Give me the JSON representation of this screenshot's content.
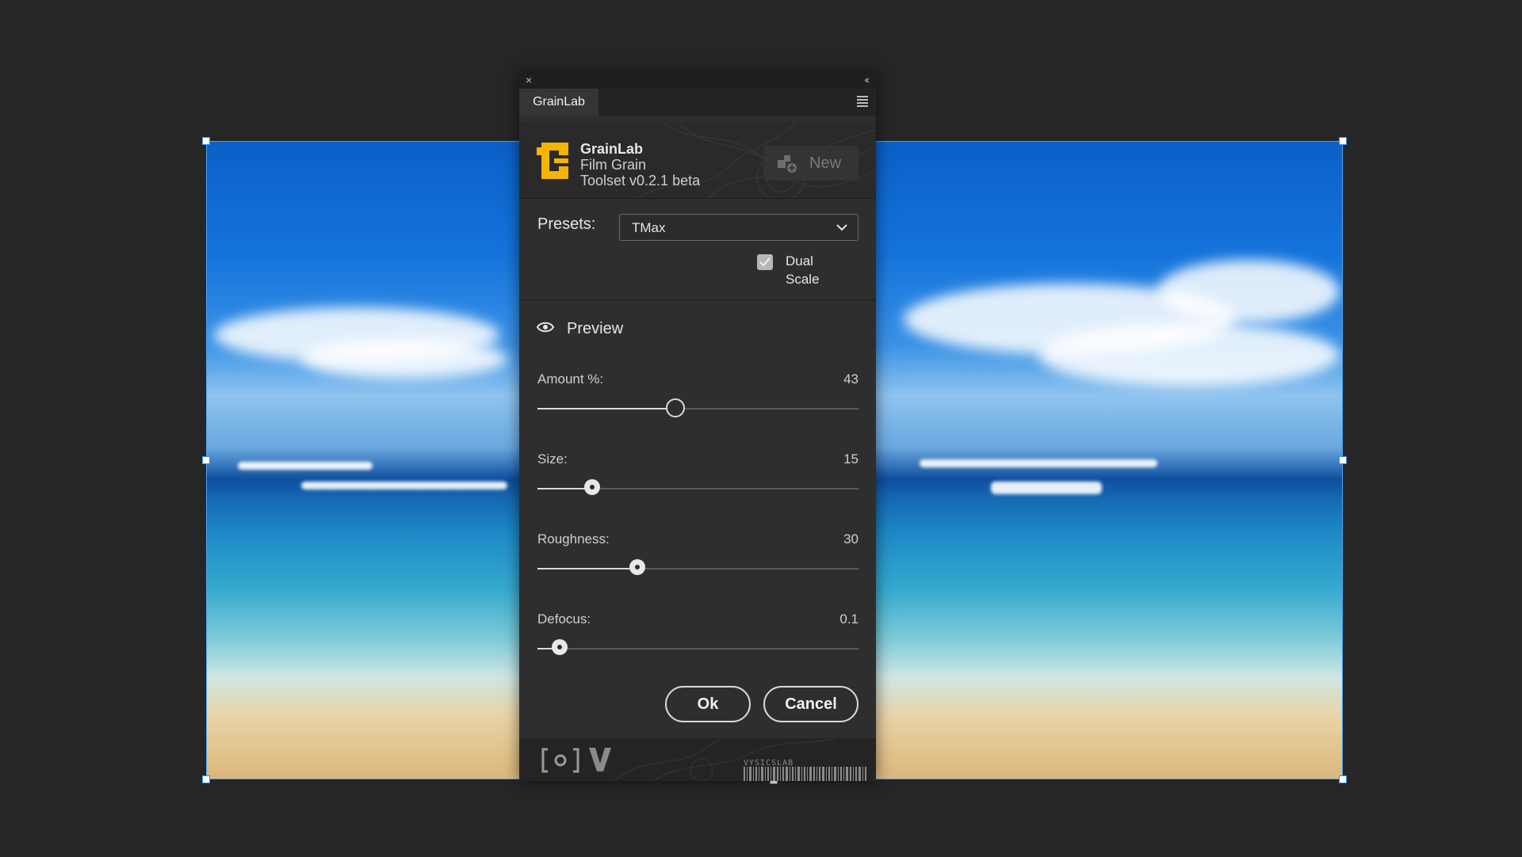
{
  "panel": {
    "tab_label": "GrainLab",
    "brand": {
      "title": "GrainLab",
      "line2": "Film Grain",
      "line3": "Toolset v0.2.1 beta"
    },
    "new_button_label": "New",
    "presets": {
      "label": "Presets:",
      "selected": "TMax"
    },
    "dual_scale": {
      "label_line1": "Dual",
      "label_line2": "Scale",
      "checked": true
    },
    "preview_label": "Preview",
    "sliders": [
      {
        "label": "Amount %:",
        "value": "43",
        "fraction": 0.43
      },
      {
        "label": "Size:",
        "value": "15",
        "fraction": 0.17
      },
      {
        "label": "Roughness:",
        "value": "30",
        "fraction": 0.31
      },
      {
        "label": "Defocus:",
        "value": "0.1",
        "fraction": 0.07
      }
    ],
    "ok_label": "Ok",
    "cancel_label": "Cancel",
    "footer_brand": "VYSICSLAB"
  },
  "colors": {
    "accent_logo": "#f5b400",
    "selection": "#4aa3f0",
    "panel_bg": "#2e2e2e"
  }
}
